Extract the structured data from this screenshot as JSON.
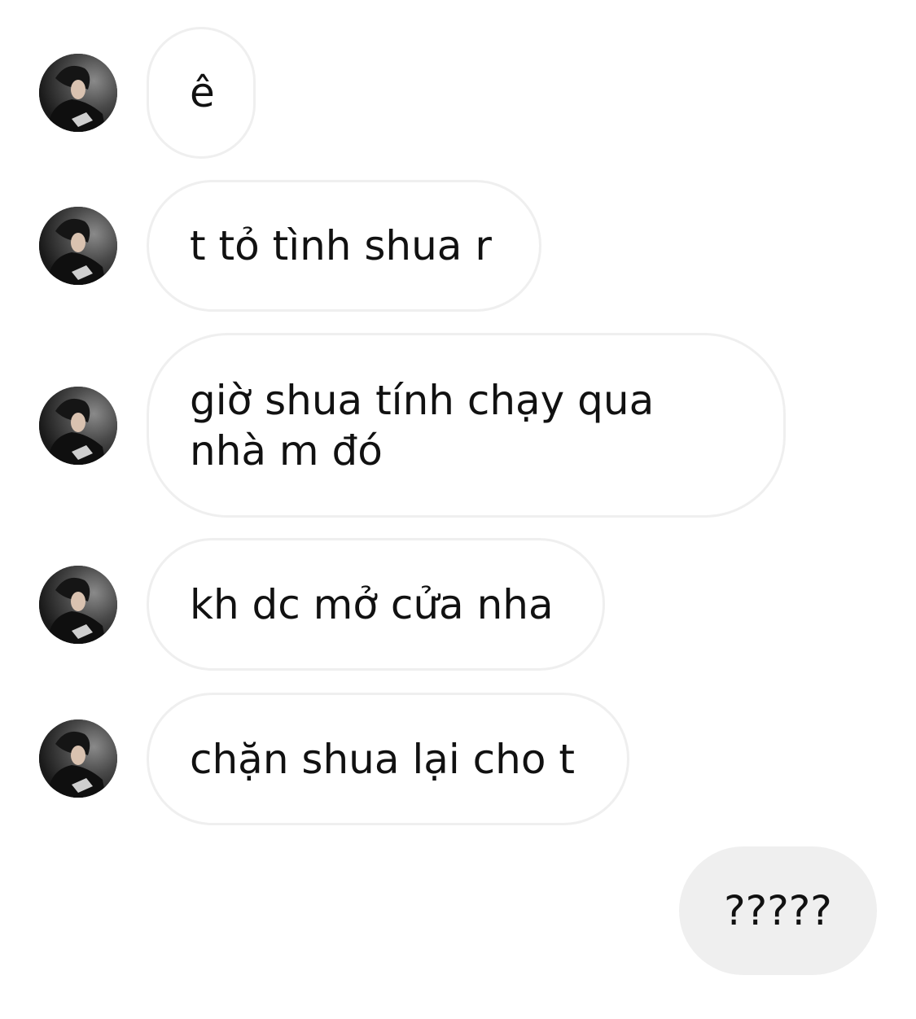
{
  "conversation": {
    "messages": [
      {
        "sender": "other",
        "text": "ê"
      },
      {
        "sender": "other",
        "text": "t tỏ tình shua r"
      },
      {
        "sender": "other",
        "text": "giờ shua tính chạy qua nhà m đó"
      },
      {
        "sender": "other",
        "text": "kh dc mở cửa nha"
      },
      {
        "sender": "other",
        "text": "chặn shua lại cho t"
      },
      {
        "sender": "me",
        "text": "?????"
      }
    ]
  },
  "colors": {
    "incoming_bubble_border": "#efefef",
    "incoming_bubble_bg": "#ffffff",
    "outgoing_bubble_bg": "#efefef",
    "text": "#111111"
  },
  "icons": {
    "avatar": "profile-photo-icon"
  }
}
